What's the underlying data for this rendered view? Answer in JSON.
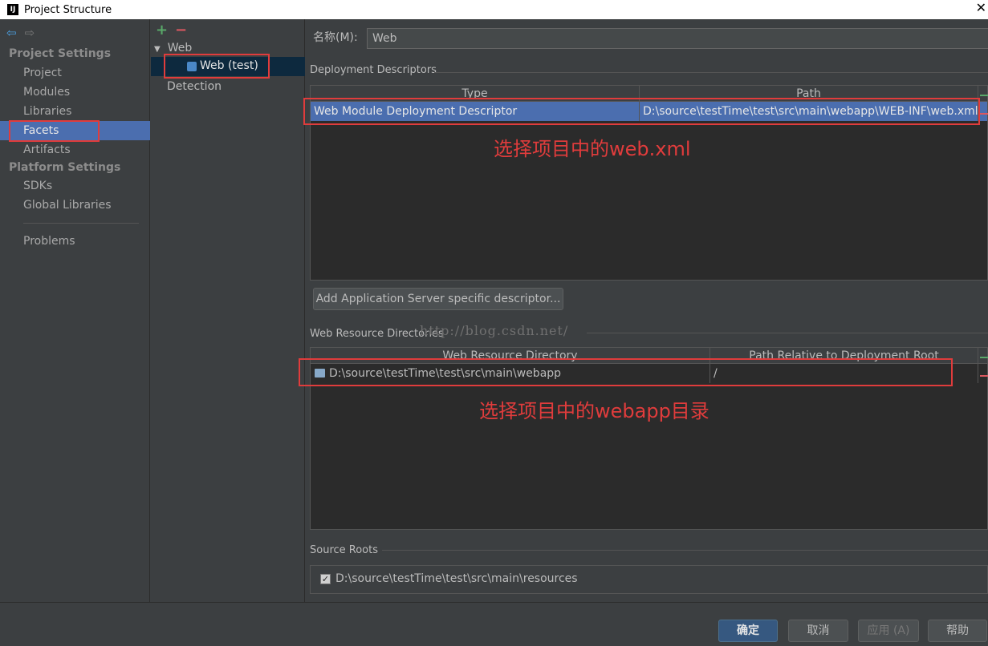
{
  "window": {
    "title": "Project Structure"
  },
  "nav": {
    "project_settings_header": "Project Settings",
    "project_items": [
      "Project",
      "Modules",
      "Libraries",
      "Facets",
      "Artifacts"
    ],
    "platform_settings_header": "Platform Settings",
    "platform_items": [
      "SDKs",
      "Global Libraries"
    ],
    "problems": "Problems",
    "selected": "Facets"
  },
  "tree": {
    "add_symbol": "+",
    "remove_symbol": "−",
    "root": "Web",
    "child": "Web (test)",
    "detection": "Detection"
  },
  "form": {
    "name_label": "名称(M):",
    "name_value": "Web"
  },
  "deployment": {
    "section_title": "Deployment Descriptors",
    "columns": [
      "Type",
      "Path"
    ],
    "rows": [
      {
        "type": "Web Module Deployment Descriptor",
        "path": "D:\\source\\testTime\\test\\src\\main\\webapp\\WEB-INF\\web.xml"
      }
    ],
    "add_button": "Add Application Server specific descriptor..."
  },
  "web_resources": {
    "section_title": "Web Resource Directories",
    "columns": [
      "Web Resource Directory",
      "Path Relative to Deployment Root"
    ],
    "rows": [
      {
        "directory": "D:\\source\\testTime\\test\\src\\main\\webapp",
        "relative": "/"
      }
    ]
  },
  "source_roots": {
    "section_title": "Source Roots",
    "items": [
      {
        "checked": true,
        "path": "D:\\source\\testTime\\test\\src\\main\\resources"
      }
    ]
  },
  "annotations": {
    "webxml_note": "选择项目中的web.xml",
    "webapp_note": "选择项目中的webapp目录",
    "watermark": "http://blog.csdn.net/"
  },
  "footer": {
    "ok": "确定",
    "cancel": "取消",
    "apply": "应用 (A)",
    "help": "帮助"
  },
  "colors": {
    "background": "#3c3f41",
    "selection": "#4b6eaf",
    "annotation": "#e03c3c"
  }
}
